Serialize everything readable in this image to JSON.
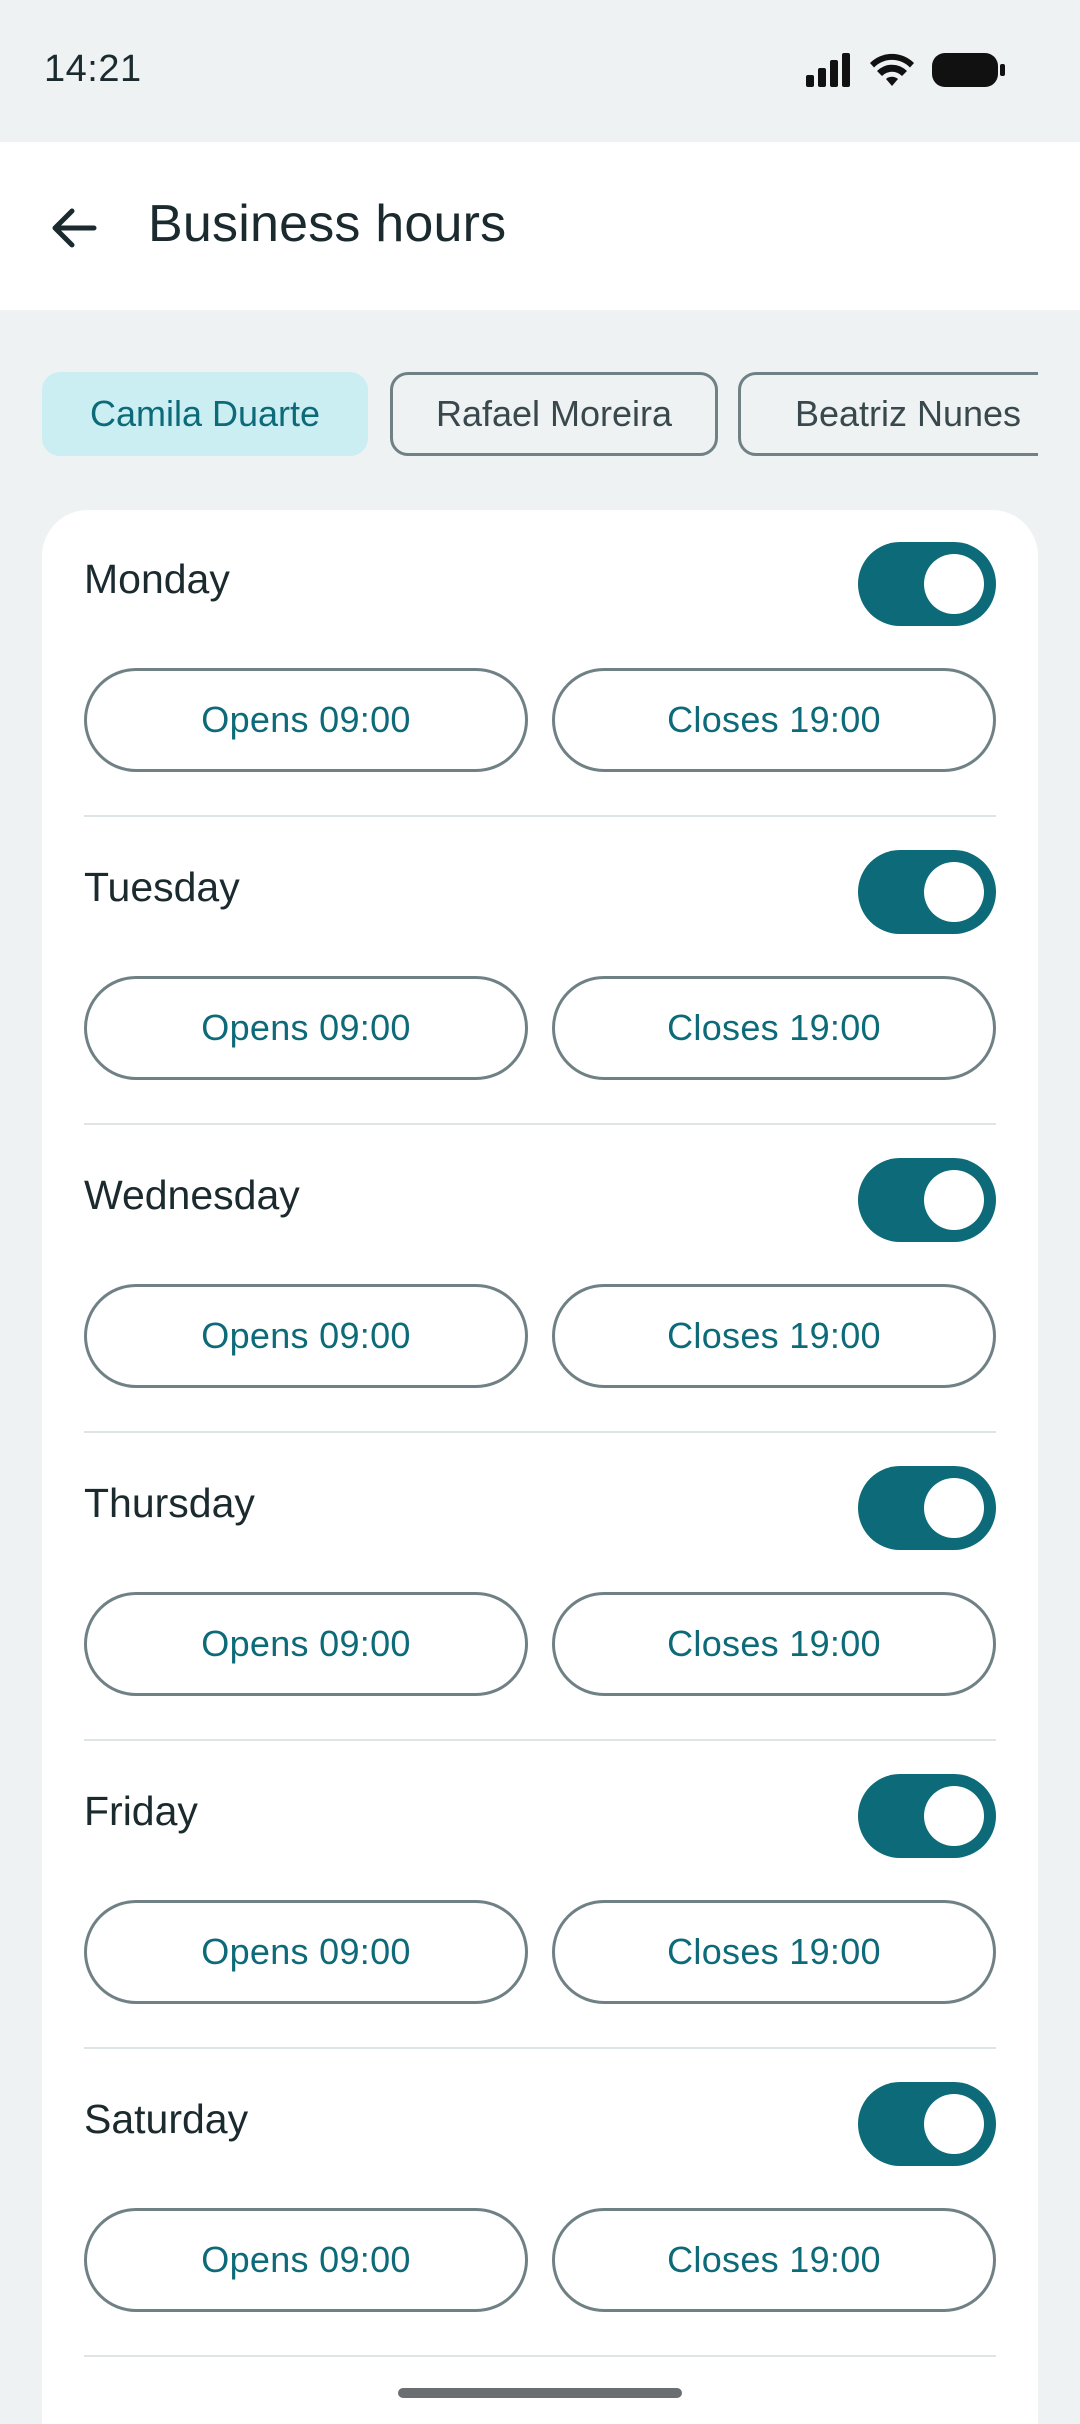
{
  "status_bar": {
    "time": "14:21",
    "icons": [
      "signal-icon",
      "wifi-icon",
      "battery-icon"
    ]
  },
  "header": {
    "back_icon": "arrow-left-icon",
    "title": "Business hours"
  },
  "staff_chips": [
    {
      "label": "Camila Duarte",
      "selected": true
    },
    {
      "label": "Rafael Moreira",
      "selected": false
    },
    {
      "label": "Beatriz Nunes",
      "selected": false
    }
  ],
  "days": [
    {
      "name": "Monday",
      "enabled": true,
      "opens": "Opens 09:00",
      "closes": "Closes 19:00"
    },
    {
      "name": "Tuesday",
      "enabled": true,
      "opens": "Opens 09:00",
      "closes": "Closes 19:00"
    },
    {
      "name": "Wednesday",
      "enabled": true,
      "opens": "Opens 09:00",
      "closes": "Closes 19:00"
    },
    {
      "name": "Thursday",
      "enabled": true,
      "opens": "Opens 09:00",
      "closes": "Closes 19:00"
    },
    {
      "name": "Friday",
      "enabled": true,
      "opens": "Opens 09:00",
      "closes": "Closes 19:00"
    },
    {
      "name": "Saturday",
      "enabled": true,
      "opens": "Opens 09:00",
      "closes": "Closes 19:00"
    }
  ],
  "colors": {
    "accent": "#0d6a78",
    "chip_selected_bg": "#cbeef3",
    "background": "#eef2f3",
    "surface": "#ffffff",
    "outline": "#6f8185"
  }
}
